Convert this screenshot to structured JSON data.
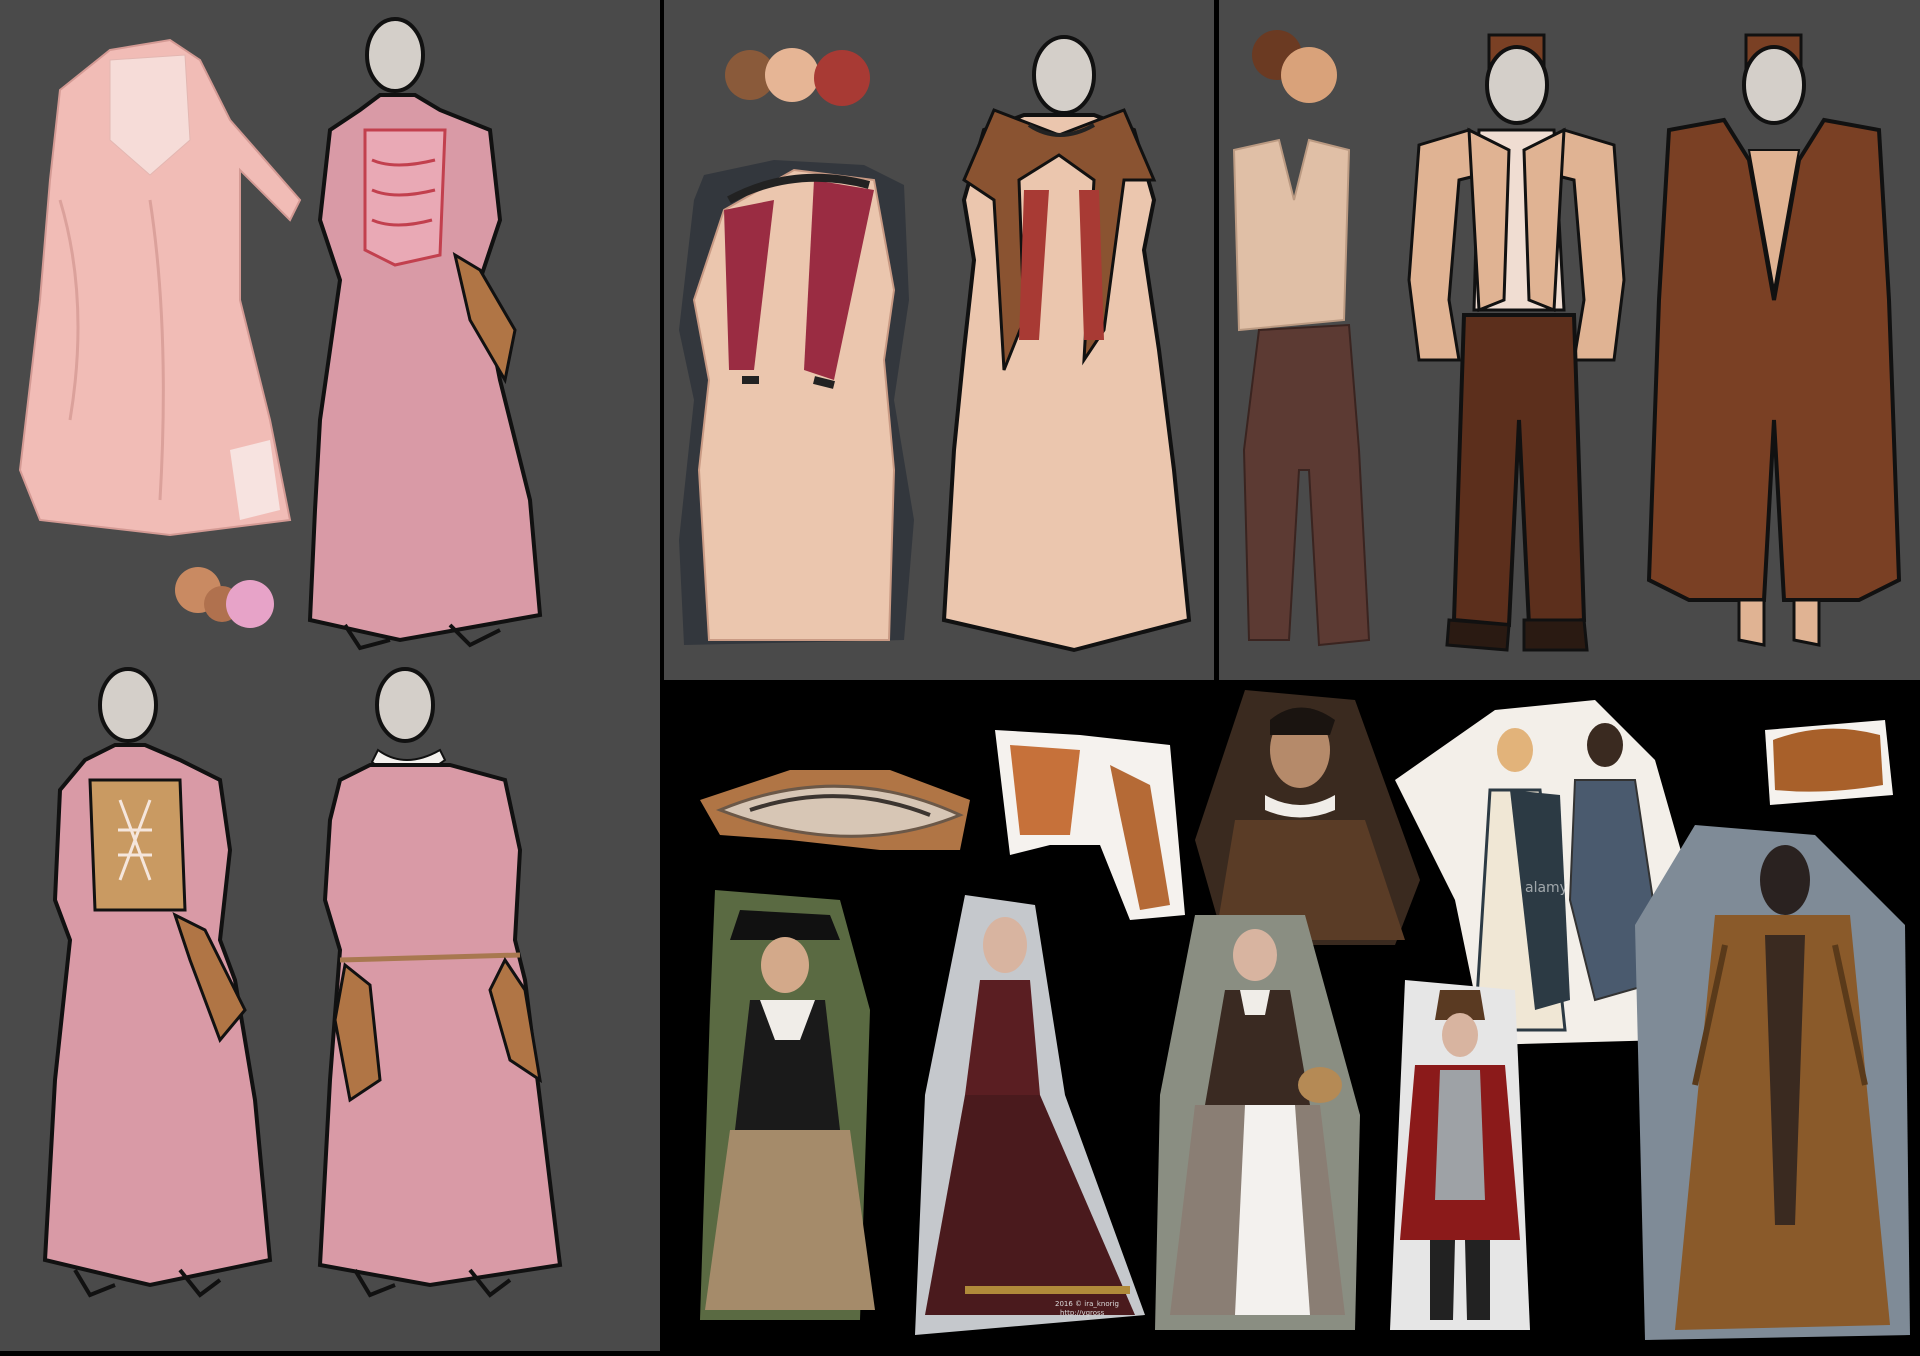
{
  "board": {
    "background": "#000000",
    "panel_color": "#4a4a4a",
    "outline_color": "#1a1a1a"
  },
  "panels": [
    {
      "id": "pink-dress-designs",
      "items": [
        "pink-dress-photo",
        "pink-dress-sketch",
        "pink-dress-bodice-sketch",
        "pink-dress-collar-sketch"
      ]
    },
    {
      "id": "cream-dress-design",
      "items": [
        "cream-dress-photo",
        "cream-dress-sketch"
      ]
    },
    {
      "id": "fur-coat-design",
      "items": [
        "vest-photo",
        "trousers-photo",
        "vest-sketch",
        "coat-sketch"
      ]
    }
  ],
  "palettes": {
    "pink_dress": [
      "#c98a62",
      "#b0714e",
      "#e7a3c8"
    ],
    "cream_dress": [
      "#8a5a3a",
      "#e6b595",
      "#a83a34"
    ],
    "fur_coat": [
      "#6b3a22",
      "#d9a27a"
    ]
  },
  "colors": {
    "pink_fabric": "#d99aa6",
    "pink_photo": "#f1bcb6",
    "cream_fabric": "#ebc6ae",
    "crimson_trim": "#9a2c42",
    "fur_brown": "#8a5331",
    "coat_brown": "#7a4024",
    "trouser_brown": "#5c2f1c",
    "vest_tan": "#e0b393",
    "skin": "#d4cfc9",
    "shirt": "#f0ddd2",
    "ochre": "#c99a62"
  },
  "reference_photos": [
    {
      "id": "fox-tail",
      "description_icon": "fur-icon"
    },
    {
      "id": "fox-pelt",
      "description_icon": "fur-icon"
    },
    {
      "id": "portrait-man-fur-collar",
      "description_icon": "portrait-icon"
    },
    {
      "id": "couple-engraving",
      "description_icon": "engraving-icon"
    },
    {
      "id": "fur-stole",
      "description_icon": "fur-icon"
    },
    {
      "id": "pilgrim-woman",
      "description_icon": "portrait-icon"
    },
    {
      "id": "burgundy-gown",
      "description_icon": "portrait-icon"
    },
    {
      "id": "woman-basket",
      "description_icon": "portrait-icon"
    },
    {
      "id": "man-red-coat",
      "description_icon": "portrait-icon"
    },
    {
      "id": "fur-coat-figure",
      "description_icon": "portrait-icon"
    }
  ],
  "watermarks": {
    "alamy": "alamy",
    "credit_line_1": "2016 © ira_knorig",
    "credit_line_2": "http://vgross"
  }
}
